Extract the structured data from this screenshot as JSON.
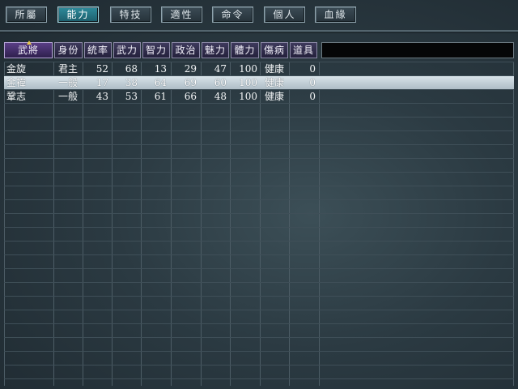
{
  "tabs": [
    {
      "id": "affiliation",
      "label": "所屬",
      "active": false
    },
    {
      "id": "ability",
      "label": "能力",
      "active": true
    },
    {
      "id": "special",
      "label": "特技",
      "active": false
    },
    {
      "id": "aptitude",
      "label": "適性",
      "active": false
    },
    {
      "id": "command",
      "label": "命令",
      "active": false
    },
    {
      "id": "personal",
      "label": "個人",
      "active": false
    },
    {
      "id": "lineage",
      "label": "血緣",
      "active": false
    }
  ],
  "columns": [
    "武將",
    "身份",
    "統率",
    "武力",
    "智力",
    "政治",
    "魅力",
    "體力",
    "傷病",
    "道具"
  ],
  "rows": [
    {
      "name": "金旋",
      "status": "君主",
      "lead": "52",
      "war": "68",
      "int": "13",
      "pol": "29",
      "cha": "47",
      "hp": "100",
      "health": "健康",
      "items": "0",
      "selected": false
    },
    {
      "name": "金禕",
      "status": "一般",
      "lead": "17",
      "war": "38",
      "int": "64",
      "pol": "69",
      "cha": "60",
      "hp": "100",
      "health": "健康",
      "items": "0",
      "selected": true
    },
    {
      "name": "鞏志",
      "status": "一般",
      "lead": "43",
      "war": "53",
      "int": "61",
      "pol": "66",
      "cha": "48",
      "hp": "100",
      "health": "健康",
      "items": "0",
      "selected": false
    }
  ],
  "colors": {
    "active_tab": "#2f8b9b",
    "header_purple": "#3e3a5c",
    "selected_row": "#c6d3da",
    "sort_marker": "#e8c84a"
  },
  "icons": {
    "sort_indicator": "sort-up-triangle-icon"
  }
}
